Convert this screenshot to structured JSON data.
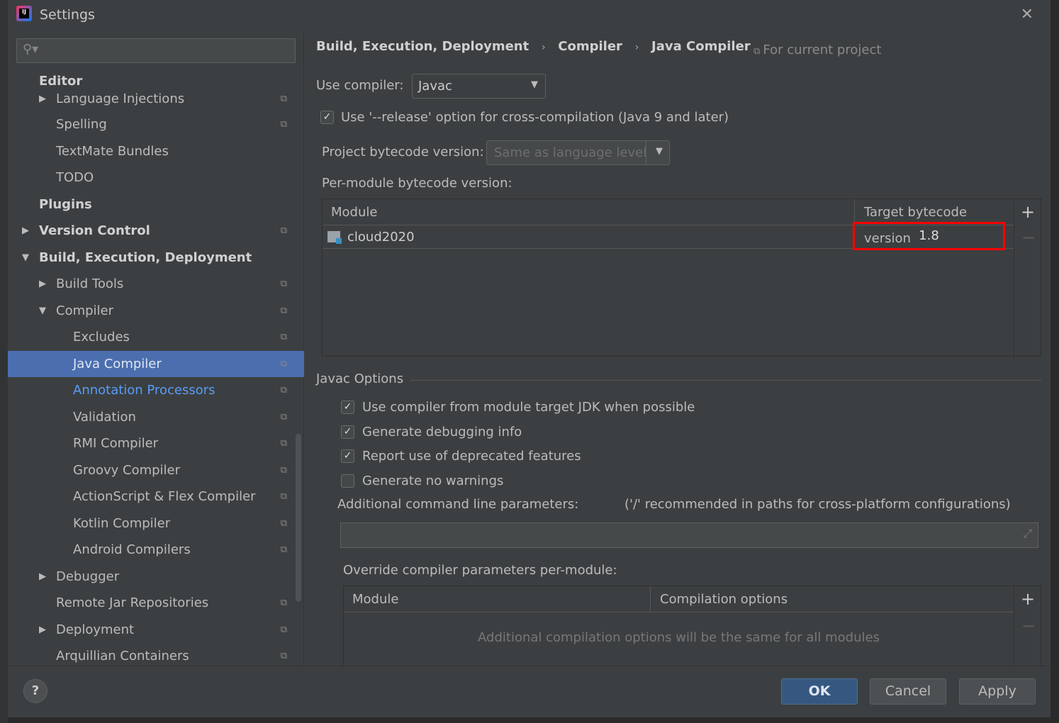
{
  "window": {
    "title": "Settings",
    "close_icon": "close-icon"
  },
  "search": {
    "placeholder": "",
    "icon": "search-icon"
  },
  "sidebar": {
    "items": [
      {
        "label": "Editor",
        "level": 0,
        "bold": true
      },
      {
        "label": "Language Injections",
        "level": 1,
        "arrow": "right",
        "copy": true
      },
      {
        "label": "Spelling",
        "level": 1,
        "copy": true
      },
      {
        "label": "TextMate Bundles",
        "level": 1
      },
      {
        "label": "TODO",
        "level": 1
      },
      {
        "label": "Plugins",
        "level": 0,
        "bold": true
      },
      {
        "label": "Version Control",
        "level": 0,
        "bold": true,
        "arrow": "right",
        "copy": true
      },
      {
        "label": "Build, Execution, Deployment",
        "level": 0,
        "bold": true,
        "arrow": "down"
      },
      {
        "label": "Build Tools",
        "level": 1,
        "arrow": "right",
        "copy": true
      },
      {
        "label": "Compiler",
        "level": 1,
        "arrow": "down",
        "copy": true
      },
      {
        "label": "Excludes",
        "level": 2,
        "copy": true
      },
      {
        "label": "Java Compiler",
        "level": 2,
        "copy": true,
        "selected": true
      },
      {
        "label": "Annotation Processors",
        "level": 2,
        "copy": true,
        "link": true
      },
      {
        "label": "Validation",
        "level": 2,
        "copy": true
      },
      {
        "label": "RMI Compiler",
        "level": 2,
        "copy": true
      },
      {
        "label": "Groovy Compiler",
        "level": 2,
        "copy": true
      },
      {
        "label": "ActionScript & Flex Compiler",
        "level": 2,
        "copy": true
      },
      {
        "label": "Kotlin Compiler",
        "level": 2,
        "copy": true
      },
      {
        "label": "Android Compilers",
        "level": 2,
        "copy": true
      },
      {
        "label": "Debugger",
        "level": 1,
        "arrow": "right"
      },
      {
        "label": "Remote Jar Repositories",
        "level": 1,
        "copy": true
      },
      {
        "label": "Deployment",
        "level": 1,
        "arrow": "right",
        "copy": true
      },
      {
        "label": "Arquillian Containers",
        "level": 1,
        "copy": true
      }
    ]
  },
  "breadcrumb": [
    "Build, Execution, Deployment",
    "Compiler",
    "Java Compiler"
  ],
  "scope": "For current project",
  "compiler": {
    "label": "Use compiler:",
    "value": "Javac"
  },
  "release_option": {
    "label": "Use '--release' option for cross-compilation (Java 9 and later)",
    "checked": true
  },
  "project_bytecode": {
    "label": "Project bytecode version:",
    "value": "Same as language level"
  },
  "per_module": {
    "label": "Per-module bytecode version:",
    "columns": [
      "Module",
      "Target bytecode version"
    ],
    "rows": [
      {
        "module": "cloud2020",
        "version": "1.8"
      }
    ],
    "highlight_color": "#ff0000"
  },
  "javac": {
    "title": "Javac Options",
    "options": [
      {
        "label": "Use compiler from module target JDK when possible",
        "checked": true
      },
      {
        "label": "Generate debugging info",
        "checked": true
      },
      {
        "label": "Report use of deprecated features",
        "checked": true
      },
      {
        "label": "Generate no warnings",
        "checked": false
      }
    ],
    "params_label": "Additional command line parameters:",
    "params_hint": "('/' recommended in paths for cross-platform configurations)",
    "params_value": "",
    "override_label": "Override compiler parameters per-module:",
    "override_columns": [
      "Module",
      "Compilation options"
    ],
    "override_empty": "Additional compilation options will be the same for all modules"
  },
  "buttons": {
    "ok": "OK",
    "cancel": "Cancel",
    "apply": "Apply",
    "help": "?"
  },
  "colors": {
    "selection": "#4b6eaf",
    "ok": "#365880",
    "link": "#589df6"
  }
}
